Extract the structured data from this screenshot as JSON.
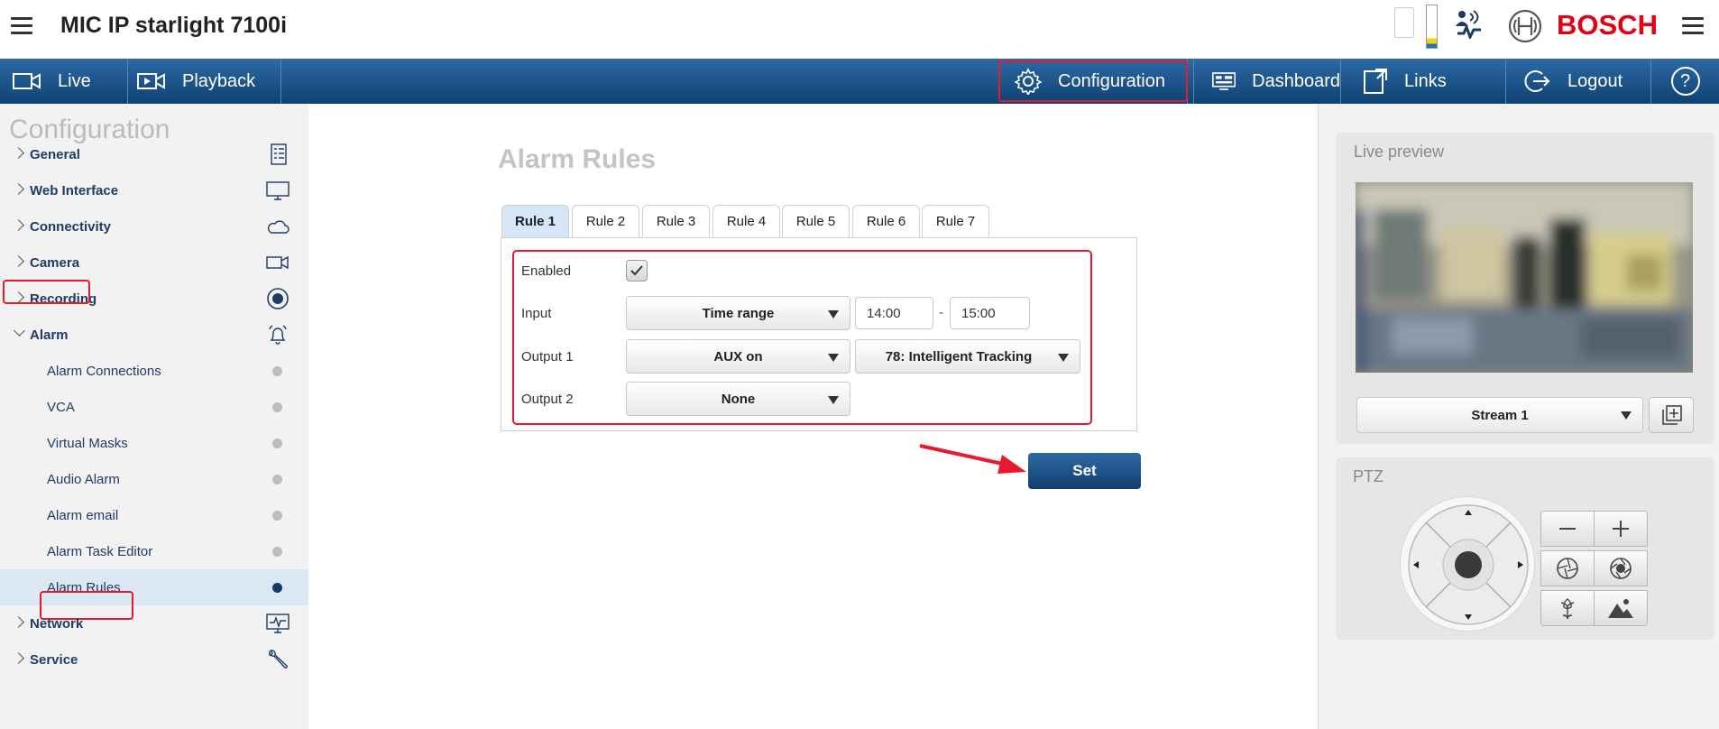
{
  "header": {
    "title": "MIC IP starlight 7100i",
    "brand": "BOSCH"
  },
  "nav": {
    "live": "Live",
    "playback": "Playback",
    "configuration": "Configuration",
    "dashboard": "Dashboard",
    "links": "Links",
    "logout": "Logout",
    "help": "?"
  },
  "sidebar": {
    "title": "Configuration",
    "items": [
      {
        "label": "General",
        "icon": "document-list-icon"
      },
      {
        "label": "Web Interface",
        "icon": "monitor-icon"
      },
      {
        "label": "Connectivity",
        "icon": "cloud-icon"
      },
      {
        "label": "Camera",
        "icon": "camera-icon"
      },
      {
        "label": "Recording",
        "icon": "record-icon"
      },
      {
        "label": "Alarm",
        "icon": "bell-icon"
      },
      {
        "label": "Network",
        "icon": "network-monitor-icon"
      },
      {
        "label": "Service",
        "icon": "wrench-icon"
      }
    ],
    "alarm_sub": [
      "Alarm Connections",
      "VCA",
      "Virtual Masks",
      "Audio Alarm",
      "Alarm email",
      "Alarm Task Editor",
      "Alarm Rules"
    ]
  },
  "main": {
    "title": "Alarm Rules",
    "tabs": [
      "Rule 1",
      "Rule 2",
      "Rule 3",
      "Rule 4",
      "Rule 5",
      "Rule 6",
      "Rule 7"
    ],
    "active_tab": "Rule 1",
    "enabled_label": "Enabled",
    "enabled": true,
    "input_label": "Input",
    "input_value": "Time range",
    "time_from": "14:00",
    "time_sep": "-",
    "time_to": "15:00",
    "output1_label": "Output 1",
    "output1_value": "AUX on",
    "output1_param": "78: Intelligent Tracking",
    "output2_label": "Output 2",
    "output2_value": "None",
    "set_label": "Set"
  },
  "right": {
    "preview_title": "Live preview",
    "stream_value": "Stream 1",
    "ptz_title": "PTZ"
  },
  "colors": {
    "accent": "#e20015",
    "nav_blue": "#1b5185",
    "highlight": "#e8192c",
    "link": "#1f3c66"
  }
}
